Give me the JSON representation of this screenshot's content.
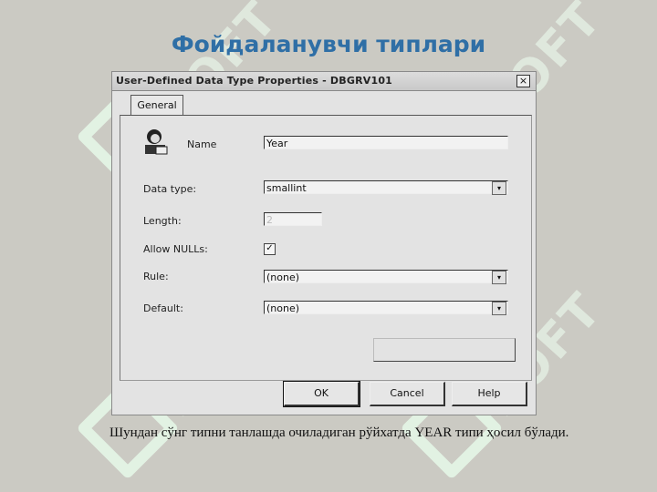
{
  "slide_title": "Фойдаланувчи типлари",
  "dialog": {
    "title": "User-Defined Data Type Properties - DBGRV101",
    "close_glyph": "×",
    "tab_general": "General",
    "labels": {
      "name": "Name",
      "data_type": "Data type:",
      "length": "Length:",
      "allow_nulls": "Allow NULLs:",
      "rule": "Rule:",
      "default": "Default:"
    },
    "values": {
      "name": "Year",
      "data_type": "smallint",
      "length": "2",
      "allow_nulls_checked": true,
      "allow_nulls_glyph": "✓",
      "rule": "(none)",
      "default": "(none)"
    },
    "dropdown_glyph": "▾",
    "buttons": {
      "ok": "OK",
      "cancel": "Cancel",
      "help": "Help"
    }
  },
  "caption": "Шундан сўнг типни танлашда очиладиган рўйхатда YEAR типи ҳосил бўлади.",
  "watermark_text": "SOFT",
  "colors": {
    "title": "#2f6fa6",
    "background": "#cbcac3",
    "watermark": "#e2f2e3"
  }
}
